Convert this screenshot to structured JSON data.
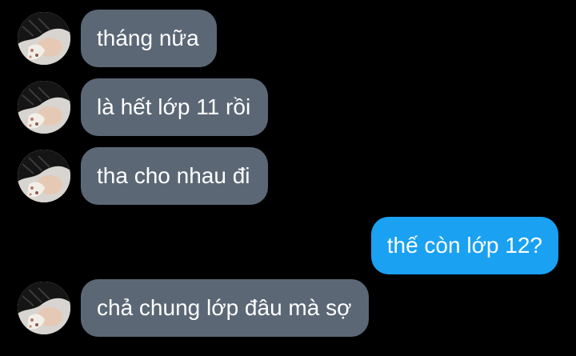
{
  "conversation": {
    "messages": [
      {
        "sender": "other",
        "text": "tháng nữa",
        "show_avatar": true
      },
      {
        "sender": "other",
        "text": "là hết lớp 11 rồi",
        "show_avatar": true
      },
      {
        "sender": "other",
        "text": "tha cho nhau đi",
        "show_avatar": true
      },
      {
        "sender": "me",
        "text": "thế còn lớp 12?",
        "show_avatar": false
      },
      {
        "sender": "other",
        "text": "chả chung lớp đâu mà sợ",
        "show_avatar": true
      }
    ]
  },
  "colors": {
    "background": "#000000",
    "incoming_bubble": "#5b6775",
    "outgoing_bubble": "#1aa1f2",
    "text": "#ffffff"
  },
  "icons": {
    "avatar": "contact-avatar-photo"
  }
}
